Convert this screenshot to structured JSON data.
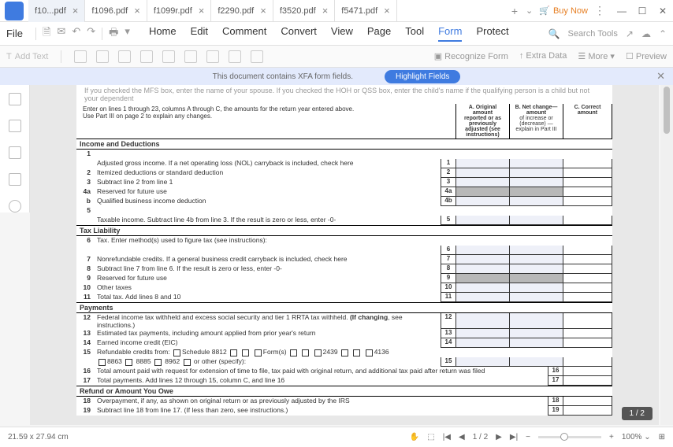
{
  "tabs": [
    "f10...pdf",
    "f1096.pdf",
    "f1099r.pdf",
    "f2290.pdf",
    "f3520.pdf",
    "f5471.pdf"
  ],
  "buy_now": "Buy Now",
  "menu": {
    "file": "File",
    "items": [
      "Home",
      "Edit",
      "Comment",
      "Convert",
      "View",
      "Page",
      "Tool",
      "Form",
      "Protect"
    ]
  },
  "search_tools": "Search Tools",
  "toolbar": {
    "add_text": "Add Text",
    "recognize": "Recognize Form",
    "extra": "Extra Data",
    "more": "More",
    "preview": "Preview"
  },
  "notice": {
    "text": "This document contains XFA form fields.",
    "button": "Highlight Fields"
  },
  "doc": {
    "cutoff": "If you checked the MFS box, enter the name of your spouse. If you checked the HOH or QSS box, enter the child's name if the qualifying person is a child but not your dependent",
    "instr1": "Enter on lines 1 through 23, columns A through C, the amounts for the return year entered above.",
    "instr2": "Use Part III on page 2 to explain any changes.",
    "cols": {
      "a": "A. Original amount",
      "a2": "reported or as previously adjusted (see instructions)",
      "b": "B. Net change—amount",
      "b2": "of increase or (decrease) — explain in Part III",
      "c": "C. Correct   amount"
    },
    "sec1": "Income and Deductions",
    "lines1": [
      {
        "n": "1",
        "d": "",
        "cells": false
      },
      {
        "n": "",
        "d": "Adjusted gross income. If a net operating loss (NOL) carryback is included, check here",
        "cells": "1"
      },
      {
        "n": "2",
        "d": "Itemized deductions or standard deduction",
        "cells": "2"
      },
      {
        "n": "3",
        "d": "Subtract line 2 from line 1",
        "cells": "3"
      },
      {
        "n": "4a",
        "d": "Reserved for future use",
        "cells": "4a",
        "grey": true
      },
      {
        "n": "b",
        "d": "Qualified business income deduction",
        "cells": "4b"
      },
      {
        "n": "5",
        "d": "",
        "cells": false
      },
      {
        "n": "",
        "d": "Taxable income. Subtract line 4b from line 3. If the result is zero or less, enter -0-",
        "cells": "5"
      }
    ],
    "sec2": "Tax Liability",
    "lines2": [
      {
        "n": "6",
        "d": "Tax. Enter method(s) used to figure tax (see instructions):",
        "cells": false
      },
      {
        "n": "",
        "d": "",
        "cells": "6"
      },
      {
        "n": "7",
        "d": "Nonrefundable credits. If a general business credit carryback is included, check here",
        "cells": "7"
      },
      {
        "n": "8",
        "d": "Subtract line 7 from line 6. If the result is zero or less, enter -0-",
        "cells": "8"
      },
      {
        "n": "9",
        "d": "Reserved for future use",
        "cells": "9",
        "grey": true
      },
      {
        "n": "10",
        "d": "Other taxes",
        "cells": "10"
      },
      {
        "n": "11",
        "d": "Total tax. Add lines 8 and 10",
        "cells": "11"
      }
    ],
    "sec3": "Payments",
    "lines3": [
      {
        "n": "12",
        "d": "Federal income tax withheld and excess social security and tier 1 RRTA tax withheld. (If changing, see instructions.)",
        "cells": "12"
      },
      {
        "n": "13",
        "d": "Estimated tax payments, including amount applied from prior year's return",
        "cells": "13"
      },
      {
        "n": "14",
        "d": "Earned income credit (EIC)",
        "cells": "14"
      },
      {
        "n": "15",
        "d": "Refundable credits from:",
        "extra": "Schedule 8812      Form(s)      2439      4136",
        "cells": false
      },
      {
        "n": "",
        "d": "8863        8885        8962 or        other (specify):",
        "cells": "15"
      },
      {
        "n": "16",
        "d": "Total amount paid with request for extension of time to file, tax paid with original return, and additional  tax paid after return was filed",
        "cells": "16",
        "right": true
      },
      {
        "n": "17",
        "d": "Total payments. Add lines 12 through 15, column C, and line 16",
        "cells": "17",
        "right": true
      }
    ],
    "sec4": "Refund or Amount You Owe",
    "lines4": [
      {
        "n": "18",
        "d": "Overpayment, if any, as shown on original return or as previously adjusted by the IRS",
        "cells": "18",
        "right": true
      },
      {
        "n": "19",
        "d": "Subtract line 18 from line 17. (If less than zero, see instructions.)",
        "cells": "19",
        "right": true
      }
    ]
  },
  "status": {
    "dims": "21.59 x 27.94 cm",
    "page": "1 / 2",
    "zoom": "100%",
    "badge": "1 / 2"
  }
}
